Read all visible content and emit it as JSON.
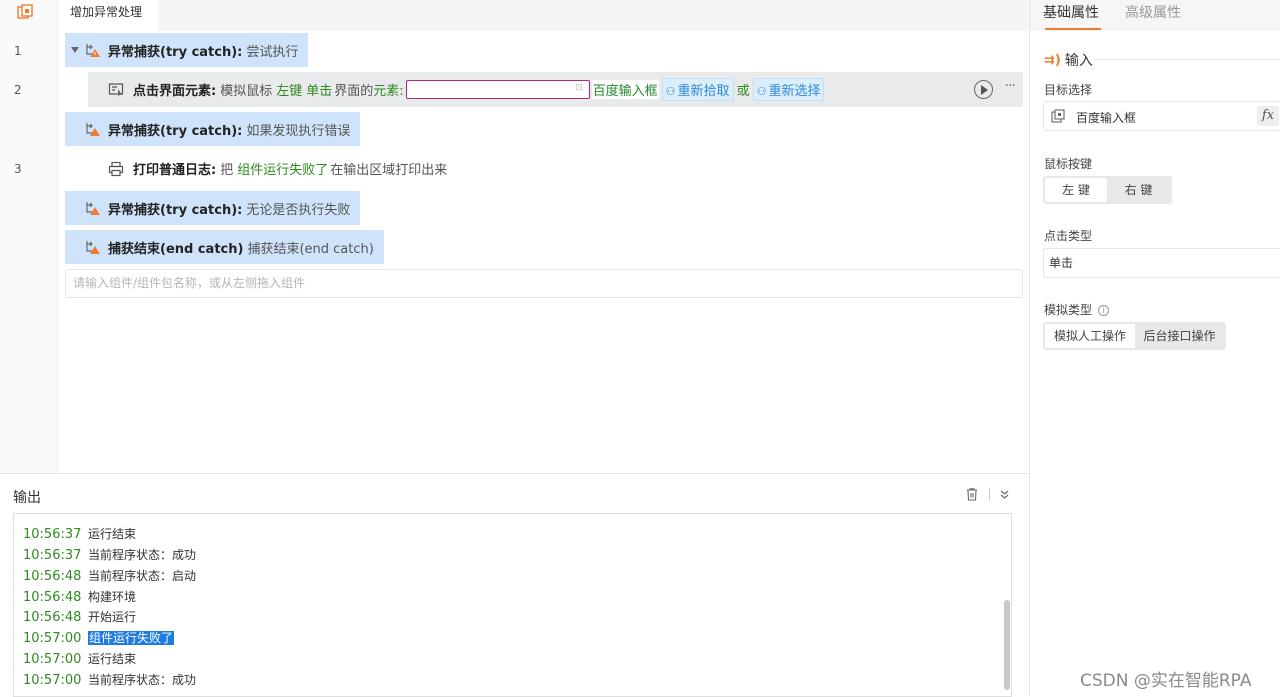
{
  "editor": {
    "tab_label": "增加异常处理",
    "line_numbers": [
      "1",
      "2",
      "3"
    ],
    "try_block": {
      "keyword": "异常捕获(try catch):",
      "desc": "尝试执行"
    },
    "click_row": {
      "title": "点击界面元素:",
      "p1": "模拟鼠标",
      "btn": "左键",
      "clicktype": "单击",
      "p2": "界面的",
      "elem_label": "元素:",
      "elem_name": "百度输入框",
      "repick": "重新拾取",
      "or": "或",
      "reselect": "重新选择"
    },
    "catch_block": {
      "keyword": "异常捕获(try catch):",
      "desc": "如果发现执行错误"
    },
    "log_row": {
      "title": "打印普通日志:",
      "p1": "把",
      "var": "组件运行失败了",
      "p2": "在输出区域打印出来"
    },
    "finally_block": {
      "keyword": "异常捕获(try catch):",
      "desc": "无论是否执行失败"
    },
    "end_block": {
      "keyword": "捕获结束(end catch)",
      "desc": "捕获结束(end catch)"
    },
    "component_input_placeholder": "请输入组件/组件包名称，或从左侧拖入组件"
  },
  "output": {
    "title": "输出",
    "logs": [
      {
        "time": "10:56:37",
        "msg": "运行结束"
      },
      {
        "time": "10:56:37",
        "msg": "当前程序状态：成功"
      },
      {
        "time": "10:56:48",
        "msg": "当前程序状态：启动"
      },
      {
        "time": "10:56:48",
        "msg": "构建环境"
      },
      {
        "time": "10:56:48",
        "msg": "开始运行"
      },
      {
        "time": "10:57:00",
        "msg": "组件运行失败了",
        "highlight": true
      },
      {
        "time": "10:57:00",
        "msg": "运行结束"
      },
      {
        "time": "10:57:00",
        "msg": "当前程序状态：成功"
      }
    ]
  },
  "props": {
    "tab_basic": "基础属性",
    "tab_advanced": "高级属性",
    "section_input": "输入",
    "target_label": "目标选择",
    "target_value": "百度输入框",
    "fx": "fx",
    "mouse_label": "鼠标按键",
    "mouse_left": "左 键",
    "mouse_right": "右 键",
    "clicktype_label": "点击类型",
    "clicktype_value": "单击",
    "simtype_label": "模拟类型",
    "info": "i",
    "sim_manual": "模拟人工操作",
    "sim_backend": "后台接口操作"
  },
  "watermark": "CSDN @实在智能RPA",
  "colors": {
    "accent": "#f07a2f",
    "catch_bg": "#cfe4fb",
    "time_green": "#2e8b1e",
    "chip_blue": "#2f8ad8"
  }
}
